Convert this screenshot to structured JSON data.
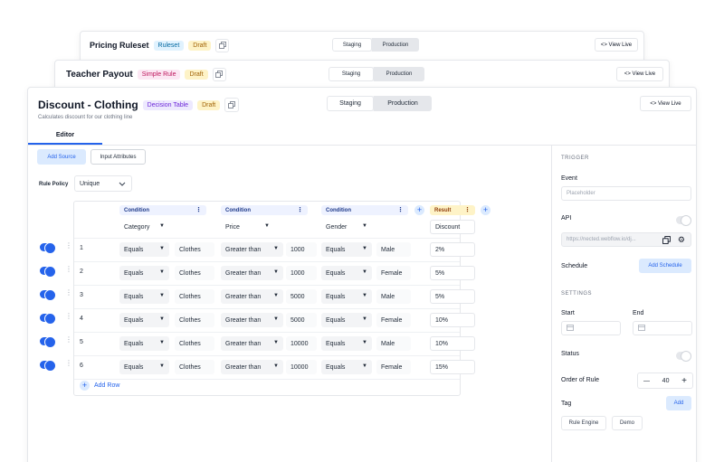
{
  "back_card_1": {
    "title": "Pricing Ruleset",
    "type": "Ruleset",
    "status": "Draft",
    "staging": "Staging",
    "production": "Production",
    "view_live": "<> View Live"
  },
  "back_card_2": {
    "title": "Teacher Payout",
    "type": "Simple Rule",
    "status": "Draft",
    "staging": "Staging",
    "production": "Production",
    "view_live": "<> View Live"
  },
  "main": {
    "title": "Discount - Clothing",
    "type": "Decision Table",
    "status": "Draft",
    "subtitle": "Calculates discount for our clothing line",
    "staging": "Staging",
    "production": "Production",
    "view_live": "<> View Live",
    "tab": "Editor"
  },
  "editor": {
    "add_source": "Add Source",
    "input_attributes": "Input Attributes",
    "rule_policy_label": "Rule Policy",
    "rule_policy_value": "Unique",
    "columns": [
      {
        "header": "Condition",
        "attribute": "Category"
      },
      {
        "header": "Condition",
        "attribute": "Price"
      },
      {
        "header": "Condition",
        "attribute": "Gender"
      }
    ],
    "result": {
      "header": "Result",
      "attribute": "Discount"
    },
    "rows": [
      {
        "n": "1",
        "c1_op": "Equals",
        "c1_val": "Clothes",
        "c2_op": "Greater than",
        "c2_val": "1000",
        "c3_op": "Equals",
        "c3_val": "Male",
        "result": "2%"
      },
      {
        "n": "2",
        "c1_op": "Equals",
        "c1_val": "Clothes",
        "c2_op": "Greater than",
        "c2_val": "1000",
        "c3_op": "Equals",
        "c3_val": "Female",
        "result": "5%"
      },
      {
        "n": "3",
        "c1_op": "Equals",
        "c1_val": "Clothes",
        "c2_op": "Greater than",
        "c2_val": "5000",
        "c3_op": "Equals",
        "c3_val": "Male",
        "result": "5%"
      },
      {
        "n": "4",
        "c1_op": "Equals",
        "c1_val": "Clothes",
        "c2_op": "Greater than",
        "c2_val": "5000",
        "c3_op": "Equals",
        "c3_val": "Female",
        "result": "10%"
      },
      {
        "n": "5",
        "c1_op": "Equals",
        "c1_val": "Clothes",
        "c2_op": "Greater than",
        "c2_val": "10000",
        "c3_op": "Equals",
        "c3_val": "Male",
        "result": "10%"
      },
      {
        "n": "6",
        "c1_op": "Equals",
        "c1_val": "Clothes",
        "c2_op": "Greater than",
        "c2_val": "10000",
        "c3_op": "Equals",
        "c3_val": "Female",
        "result": "15%"
      }
    ],
    "add_row": "Add Row"
  },
  "panel": {
    "trigger_label": "TRIGGER",
    "event_label": "Event",
    "event_placeholder": "Placeholder",
    "api_label": "API",
    "api_url": "https://nected.webflow.io/dj...",
    "schedule_label": "Schedule",
    "add_schedule": "Add Schedule",
    "settings_label": "SETTINGS",
    "start_label": "Start",
    "end_label": "End",
    "status_label": "Status",
    "order_label": "Order of Rule",
    "order_value": "40",
    "tag_label": "Tag",
    "add_tag": "Add",
    "tags": [
      "Rule Engine",
      "Demo"
    ]
  },
  "colors": {
    "accent": "#2563eb",
    "accent_light": "#dbeafe"
  }
}
